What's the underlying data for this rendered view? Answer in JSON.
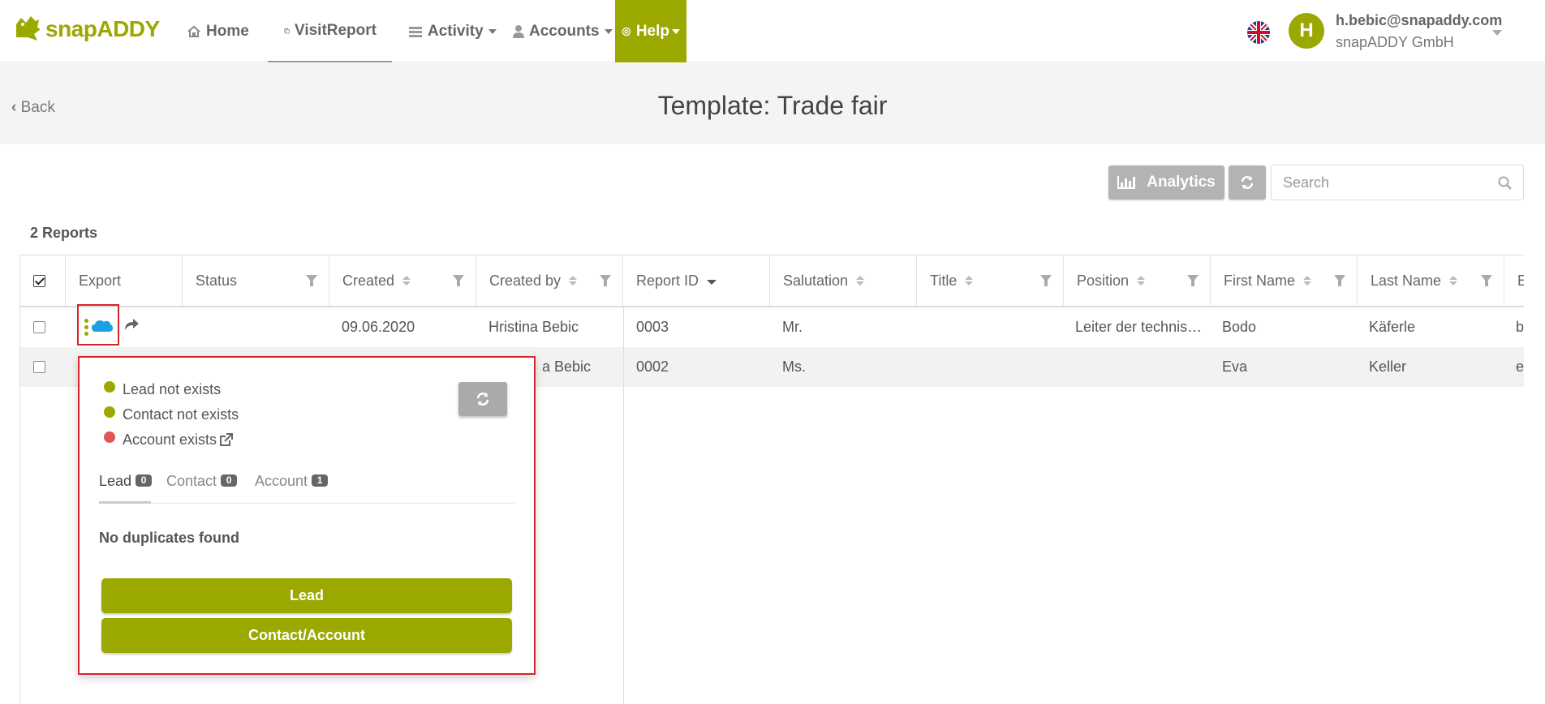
{
  "app": {
    "brand": "snapADDY",
    "brand_color": "#9aa800"
  },
  "nav": {
    "home": "Home",
    "visit_report": "VisitReport",
    "activity": "Activity",
    "accounts": "Accounts",
    "help": "Help"
  },
  "user": {
    "initial": "H",
    "email": "h.bebic@snapaddy.com",
    "company": "snapADDY GmbH"
  },
  "header": {
    "back": "Back",
    "title": "Template: Trade fair"
  },
  "toolbar": {
    "analytics_label": "Analytics",
    "search_placeholder": "Search"
  },
  "table": {
    "count_label": "2 Reports",
    "columns": {
      "export": "Export",
      "status": "Status",
      "created": "Created",
      "created_by": "Created by",
      "report_id": "Report ID",
      "salutation": "Salutation",
      "title": "Title",
      "position": "Position",
      "first_name": "First Name",
      "last_name": "Last Name",
      "next_col": "E"
    },
    "rows": [
      {
        "created": "09.06.2020",
        "created_by": "Hristina Bebic",
        "report_id": "0003",
        "salutation": "Mr.",
        "title": "",
        "position": "Leiter der technis…",
        "first_name": "Bodo",
        "last_name": "Käferle",
        "next_col": "b"
      },
      {
        "created": "",
        "created_by": "a Bebic",
        "report_id": "0002",
        "salutation": "Ms.",
        "title": "",
        "position": "",
        "first_name": "Eva",
        "last_name": "Keller",
        "next_col": "e"
      }
    ]
  },
  "popover": {
    "statuses": [
      {
        "label": "Lead not exists",
        "color": "#9aa800"
      },
      {
        "label": "Contact not exists",
        "color": "#9aa800"
      },
      {
        "label": "Account exists",
        "color": "#e05555"
      }
    ],
    "tabs": [
      {
        "label": "Lead",
        "count": "0"
      },
      {
        "label": "Contact",
        "count": "0"
      },
      {
        "label": "Account",
        "count": "1"
      }
    ],
    "no_duplicates": "No duplicates found",
    "lead_button": "Lead",
    "contact_account_button": "Contact/Account"
  }
}
